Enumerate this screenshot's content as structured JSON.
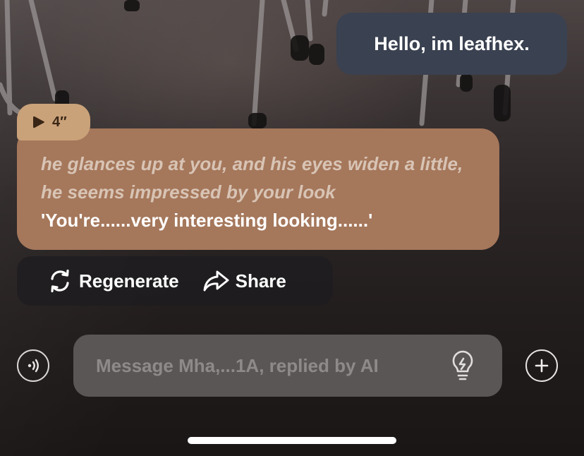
{
  "chat": {
    "user_message": "Hello, im leafhex.",
    "voice_duration": "4″",
    "ai_narration": "he glances up at you, and his eyes widen a little, he seems impressed by your look",
    "ai_speech": "'You're......very interesting looking......'"
  },
  "actions": {
    "regenerate_label": "Regenerate",
    "share_label": "Share"
  },
  "composer": {
    "placeholder": "Message Mha,...1A, replied by AI"
  },
  "icons": {
    "voice_call": "voice-call-icon",
    "hint": "lightbulb-icon",
    "add": "plus-icon",
    "play": "play-icon",
    "regenerate": "refresh-icon",
    "share": "share-arrow-icon"
  },
  "colors": {
    "user_bubble": "#3a4150",
    "ai_bubble": "#a5775b",
    "voice_tag": "#caa27a",
    "input_bg": "#5b5656"
  }
}
